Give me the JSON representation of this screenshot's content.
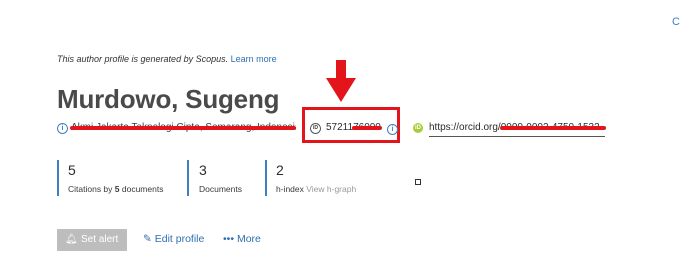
{
  "header": {
    "notice": "This author profile is generated by Scopus.",
    "learn_more": "Learn more"
  },
  "author": {
    "name": "Murdowo, Sugeng",
    "affiliation": "Akmi Jakarta Teknologi Cipta, Semarang, Indonesia",
    "scopus_id": "5721176000",
    "orcid": "https://orcid.org/0000-0002-4750-1533"
  },
  "metrics": [
    {
      "value": "5",
      "label_pre": "Citations by ",
      "label_bold": "5",
      "label_post": " documents",
      "label_muted": ""
    },
    {
      "value": "3",
      "label_pre": "Documents",
      "label_bold": "",
      "label_post": "",
      "label_muted": ""
    },
    {
      "value": "2",
      "label_pre": "h-index ",
      "label_bold": "",
      "label_post": "",
      "label_muted": "View h-graph"
    }
  ],
  "actions": {
    "set_alert": "Set alert",
    "edit_profile": "Edit profile",
    "more": "More"
  },
  "icons": {
    "info": "info-icon",
    "scopus": "scopus-id-icon",
    "orcid": "orcid-icon",
    "bell": "bell-icon",
    "pencil": "pencil-icon",
    "dots": "more-dots-icon"
  },
  "colors": {
    "accent": "#2f6fb3",
    "annotation": "#e4141b",
    "orcid": "#a6ce39"
  }
}
